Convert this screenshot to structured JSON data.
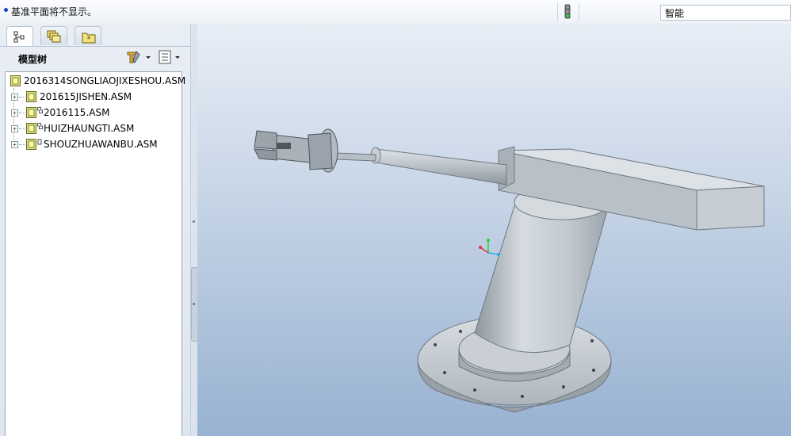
{
  "status": {
    "message": "基准平面将不显示。",
    "filter_value": "智能"
  },
  "left_panel": {
    "tabs": [
      {
        "name": "model-tree",
        "icon": "model-tree-icon"
      },
      {
        "name": "folder-browser",
        "icon": "folder-icon"
      },
      {
        "name": "favorites",
        "icon": "favorites-icon"
      }
    ],
    "title": "模型树",
    "settings_icon": "tree-settings-icon",
    "show_icon": "tree-show-icon"
  },
  "tree": {
    "root": {
      "label": "2016314SONGLIAOJIXESHOU.ASM"
    },
    "children": [
      {
        "label": "201615JISHEN.ASM",
        "expander": "+"
      },
      {
        "label": "2016115.ASM",
        "expander": "+"
      },
      {
        "label": "HUIZHAUNGTI.ASM",
        "expander": "+"
      },
      {
        "label": "SHOUZHUAWANBU.ASM",
        "expander": "+"
      }
    ]
  },
  "colors": {
    "viewport_top": "#e8eef6",
    "viewport_bottom": "#98b2d1",
    "model_gray": "#c5ccd2",
    "asm_icon": "#e6e46a"
  }
}
